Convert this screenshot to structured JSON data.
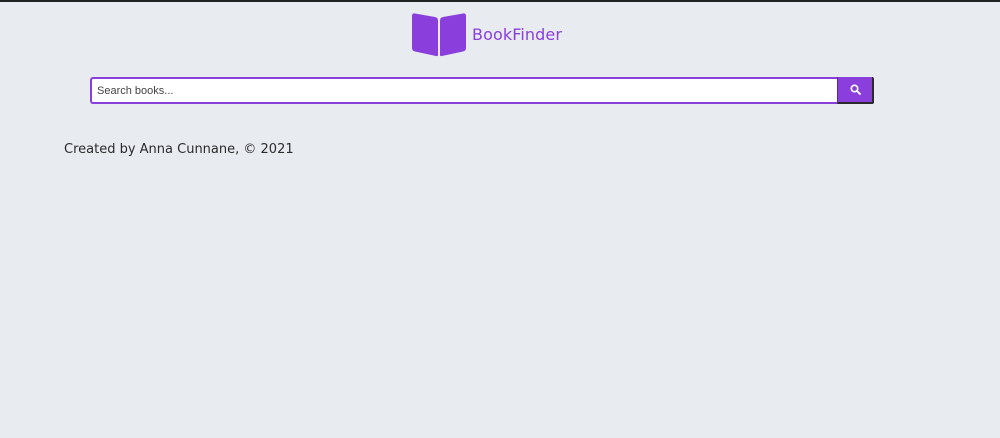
{
  "header": {
    "logo_icon": "open-book-icon",
    "title": "BookFinder"
  },
  "search": {
    "placeholder": "Search books...",
    "value": "",
    "button_icon": "search-icon"
  },
  "footer": {
    "credit": "Created by Anna Cunnane, © 2021"
  },
  "colors": {
    "accent": "#8a3fdc",
    "background": "#e8ebf0",
    "text": "#2b2b2b"
  }
}
